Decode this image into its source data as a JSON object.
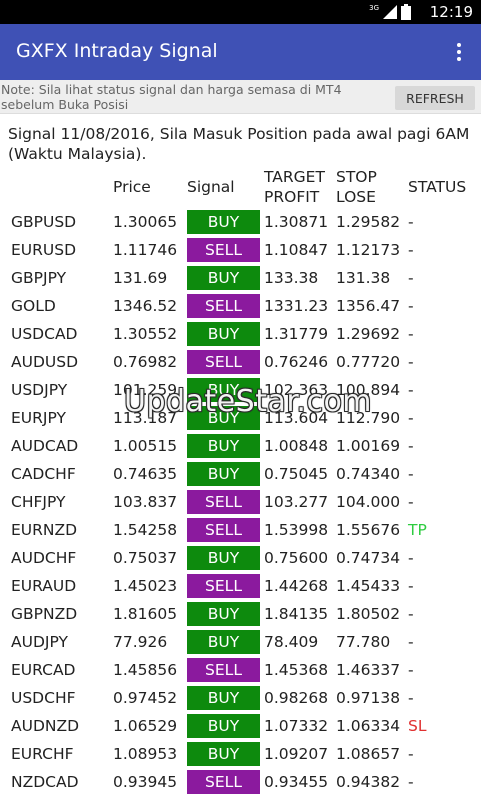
{
  "status_bar": {
    "network": "3G",
    "time": "12:19"
  },
  "app_bar": {
    "title": "GXFX Intraday Signal",
    "menu_icon": "more-vert-icon"
  },
  "note": {
    "text": "Note: Sila lihat status signal dan harga semasa di MT4 sebelum Buka Posisi",
    "refresh_label": "REFRESH"
  },
  "signal_info": "Signal 11/08/2016, Sila Masuk Position pada awal pagi 6AM (Waktu Malaysia).",
  "table": {
    "headers": {
      "price": "Price",
      "signal": "Signal",
      "tp_line1": "TARGET",
      "tp_line2": "PROFIT",
      "sl_line1": "STOP",
      "sl_line2": "LOSE",
      "status": "STATUS"
    },
    "rows": [
      {
        "pair": "GBPUSD",
        "price": "1.30065",
        "signal": "BUY",
        "tp": "1.30871",
        "sl": "1.29582",
        "status": "-"
      },
      {
        "pair": "EURUSD",
        "price": "1.11746",
        "signal": "SELL",
        "tp": "1.10847",
        "sl": "1.12173",
        "status": "-"
      },
      {
        "pair": "GBPJPY",
        "price": "131.69",
        "signal": "BUY",
        "tp": "133.38",
        "sl": "131.38",
        "status": "-"
      },
      {
        "pair": "GOLD",
        "price": "1346.52",
        "signal": "SELL",
        "tp": "1331.23",
        "sl": "1356.47",
        "status": "-"
      },
      {
        "pair": "USDCAD",
        "price": "1.30552",
        "signal": "BUY",
        "tp": "1.31779",
        "sl": "1.29692",
        "status": "-"
      },
      {
        "pair": "AUDUSD",
        "price": "0.76982",
        "signal": "SELL",
        "tp": "0.76246",
        "sl": "0.77720",
        "status": "-"
      },
      {
        "pair": "USDJPY",
        "price": "101.259",
        "signal": "BUY",
        "tp": "102.363",
        "sl": "100.894",
        "status": "-"
      },
      {
        "pair": "EURJPY",
        "price": "113.187",
        "signal": "BUY",
        "tp": "113.604",
        "sl": "112.790",
        "status": "-"
      },
      {
        "pair": "AUDCAD",
        "price": "1.00515",
        "signal": "BUY",
        "tp": "1.00848",
        "sl": "1.00169",
        "status": "-"
      },
      {
        "pair": "CADCHF",
        "price": "0.74635",
        "signal": "BUY",
        "tp": "0.75045",
        "sl": "0.74340",
        "status": "-"
      },
      {
        "pair": "CHFJPY",
        "price": "103.837",
        "signal": "SELL",
        "tp": "103.277",
        "sl": "104.000",
        "status": "-"
      },
      {
        "pair": "EURNZD",
        "price": "1.54258",
        "signal": "SELL",
        "tp": "1.53998",
        "sl": "1.55676",
        "status": "TP"
      },
      {
        "pair": "AUDCHF",
        "price": "0.75037",
        "signal": "BUY",
        "tp": "0.75600",
        "sl": "0.74734",
        "status": "-"
      },
      {
        "pair": "EURAUD",
        "price": "1.45023",
        "signal": "SELL",
        "tp": "1.44268",
        "sl": "1.45433",
        "status": "-"
      },
      {
        "pair": "GBPNZD",
        "price": "1.81605",
        "signal": "BUY",
        "tp": "1.84135",
        "sl": "1.80502",
        "status": "-"
      },
      {
        "pair": "AUDJPY",
        "price": "77.926",
        "signal": "BUY",
        "tp": "78.409",
        "sl": "77.780",
        "status": "-"
      },
      {
        "pair": "EURCAD",
        "price": "1.45856",
        "signal": "SELL",
        "tp": "1.45368",
        "sl": "1.46337",
        "status": "-"
      },
      {
        "pair": "USDCHF",
        "price": "0.97452",
        "signal": "BUY",
        "tp": "0.98268",
        "sl": "0.97138",
        "status": "-"
      },
      {
        "pair": "AUDNZD",
        "price": "1.06529",
        "signal": "BUY",
        "tp": "1.07332",
        "sl": "1.06334",
        "status": "SL"
      },
      {
        "pair": "EURCHF",
        "price": "1.08953",
        "signal": "BUY",
        "tp": "1.09207",
        "sl": "1.08657",
        "status": "-"
      },
      {
        "pair": "NZDCAD",
        "price": "0.93945",
        "signal": "SELL",
        "tp": "0.93455",
        "sl": "0.94382",
        "status": "-"
      }
    ]
  },
  "watermark": "UpdateStar.com",
  "colors": {
    "app_bar": "#3f51b5",
    "buy": "#0d8a0d",
    "sell": "#8b1a9e",
    "tp_status": "#2ecc40",
    "sl_status": "#e03030"
  }
}
